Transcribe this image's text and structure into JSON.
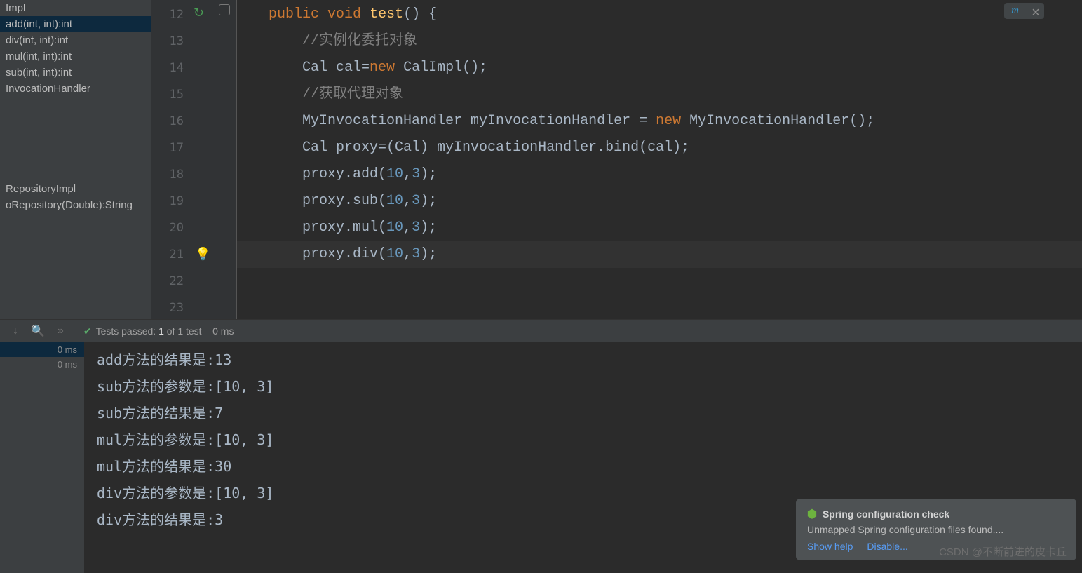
{
  "sidePanel": {
    "items": [
      {
        "label": "Impl"
      },
      {
        "label": "add(int, int):int",
        "selected": true
      },
      {
        "label": "div(int, int):int"
      },
      {
        "label": "mul(int, int):int"
      },
      {
        "label": "sub(int, int):int"
      },
      {
        "label": "InvocationHandler"
      }
    ],
    "lowerItems": [
      {
        "label": "RepositoryImpl"
      },
      {
        "label": "oRepository(Double):String"
      }
    ]
  },
  "gutter": {
    "start": 12,
    "end": 23
  },
  "code": [
    {
      "indent": 0,
      "tokens": [
        {
          "t": "public",
          "c": "kw"
        },
        {
          "t": " ",
          "c": "ident"
        },
        {
          "t": "void",
          "c": "kw"
        },
        {
          "t": " ",
          "c": "ident"
        },
        {
          "t": "test",
          "c": "fn"
        },
        {
          "t": "() {",
          "c": "ident"
        }
      ]
    },
    {
      "indent": 1,
      "tokens": [
        {
          "t": "//实例化委托对象",
          "c": "com"
        }
      ]
    },
    {
      "indent": 1,
      "tokens": [
        {
          "t": "Cal cal=",
          "c": "ident"
        },
        {
          "t": "new",
          "c": "kw"
        },
        {
          "t": " ",
          "c": "ident"
        },
        {
          "t": "CalImpl",
          "c": "ident"
        },
        {
          "t": "();",
          "c": "ident"
        }
      ]
    },
    {
      "indent": 1,
      "tokens": [
        {
          "t": "//获取代理对象",
          "c": "com"
        }
      ]
    },
    {
      "indent": 1,
      "tokens": [
        {
          "t": "MyInvocationHandler myInvocationHandler = ",
          "c": "ident"
        },
        {
          "t": "new",
          "c": "kw"
        },
        {
          "t": " MyInvocationHandler();",
          "c": "ident"
        }
      ]
    },
    {
      "indent": 1,
      "tokens": [
        {
          "t": "Cal proxy=(Cal) myInvocationHandler.bind(cal);",
          "c": "ident"
        }
      ]
    },
    {
      "indent": 1,
      "tokens": [
        {
          "t": "proxy.add(",
          "c": "ident"
        },
        {
          "t": "10",
          "c": "num"
        },
        {
          "t": ",",
          "c": "ident"
        },
        {
          "t": "3",
          "c": "num"
        },
        {
          "t": ");",
          "c": "ident"
        }
      ]
    },
    {
      "indent": 1,
      "tokens": [
        {
          "t": "proxy.sub(",
          "c": "ident"
        },
        {
          "t": "10",
          "c": "num"
        },
        {
          "t": ",",
          "c": "ident"
        },
        {
          "t": "3",
          "c": "num"
        },
        {
          "t": ");",
          "c": "ident"
        }
      ]
    },
    {
      "indent": 1,
      "tokens": [
        {
          "t": "proxy.mul(",
          "c": "ident"
        },
        {
          "t": "10",
          "c": "num"
        },
        {
          "t": ",",
          "c": "ident"
        },
        {
          "t": "3",
          "c": "num"
        },
        {
          "t": ");",
          "c": "ident"
        }
      ]
    },
    {
      "indent": 1,
      "current": true,
      "tokens": [
        {
          "t": "proxy.div(",
          "c": "ident"
        },
        {
          "t": "10",
          "c": "num"
        },
        {
          "t": ",",
          "c": "ident"
        },
        {
          "t": "3",
          "c": "num"
        },
        {
          "t": ");",
          "c": "ident"
        }
      ]
    },
    {
      "indent": 0,
      "tokens": []
    },
    {
      "indent": 0,
      "tokens": []
    }
  ],
  "testHeader": {
    "prefix": "Tests passed: ",
    "count": "1",
    "suffix": " of 1 test – 0 ms"
  },
  "testTree": [
    {
      "label": "0 ms",
      "selected": true
    },
    {
      "label": "0 ms"
    }
  ],
  "console": [
    "add方法的结果是:13",
    "sub方法的参数是:[10, 3]",
    "sub方法的结果是:7",
    "mul方法的参数是:[10, 3]",
    "mul方法的结果是:30",
    "div方法的参数是:[10, 3]",
    "div方法的结果是:3"
  ],
  "notification": {
    "title": "Spring configuration check",
    "body": "Unmapped Spring configuration files found....",
    "links": [
      "Show help",
      "Disable..."
    ]
  },
  "watermark": "CSDN @不断前进的皮卡丘",
  "badge": {
    "label": "m"
  }
}
